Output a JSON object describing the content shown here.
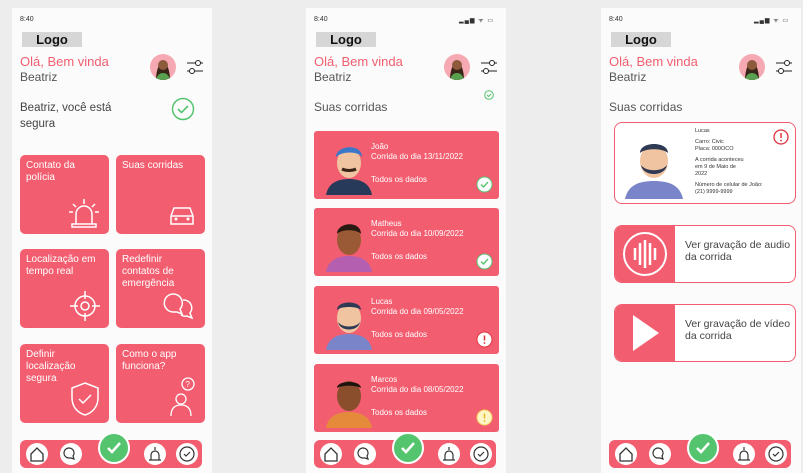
{
  "status": {
    "time": "8:40",
    "signal": "▂▄▆ ᯤ ▭"
  },
  "logo": "Logo",
  "greeting": "Olá, Bem vinda",
  "user": "Beatriz",
  "home": {
    "safe_text": "Beatriz, você está segura",
    "tiles": [
      {
        "label": "Contato da polícia",
        "icon": "siren-icon"
      },
      {
        "label": "Suas corridas",
        "icon": "car-icon"
      },
      {
        "label": "Localização em tempo real",
        "icon": "location-target-icon"
      },
      {
        "label": "Redefinir contatos de emergência",
        "icon": "chat-bubbles-icon"
      },
      {
        "label": "Definir localização segura",
        "icon": "shield-check-icon"
      },
      {
        "label": "Como o app funciona?",
        "icon": "help-person-icon"
      }
    ]
  },
  "rides": {
    "title": "Suas corridas",
    "all_label": "Todos os dados",
    "items": [
      {
        "name": "João",
        "date": "Corrida do dia 13/11/2022",
        "status": "ok"
      },
      {
        "name": "Matheus",
        "date": "Corrida do dia 10/09/2022",
        "status": "ok"
      },
      {
        "name": "Lucas",
        "date": "Corrida do dia 09/05/2022",
        "status": "alert"
      },
      {
        "name": "Marcos",
        "date": "Corrida do dia 08/05/2022",
        "status": "warning"
      }
    ]
  },
  "detail": {
    "title": "Suas corridas",
    "driver": "Lucas",
    "car": "Carro: Civic",
    "plate": "Placa: 000OCO",
    "when": "A corrida aconteceu em 9 de Maio de 2022",
    "phone_label": "Número de celular de João:",
    "phone": "(21) 9999-9999",
    "audio": "Ver gravação de audio da corrida",
    "video": "Ver gravação de vídeo da corrida"
  },
  "colors": {
    "accent": "#f25e70",
    "ok": "#55c46e"
  }
}
